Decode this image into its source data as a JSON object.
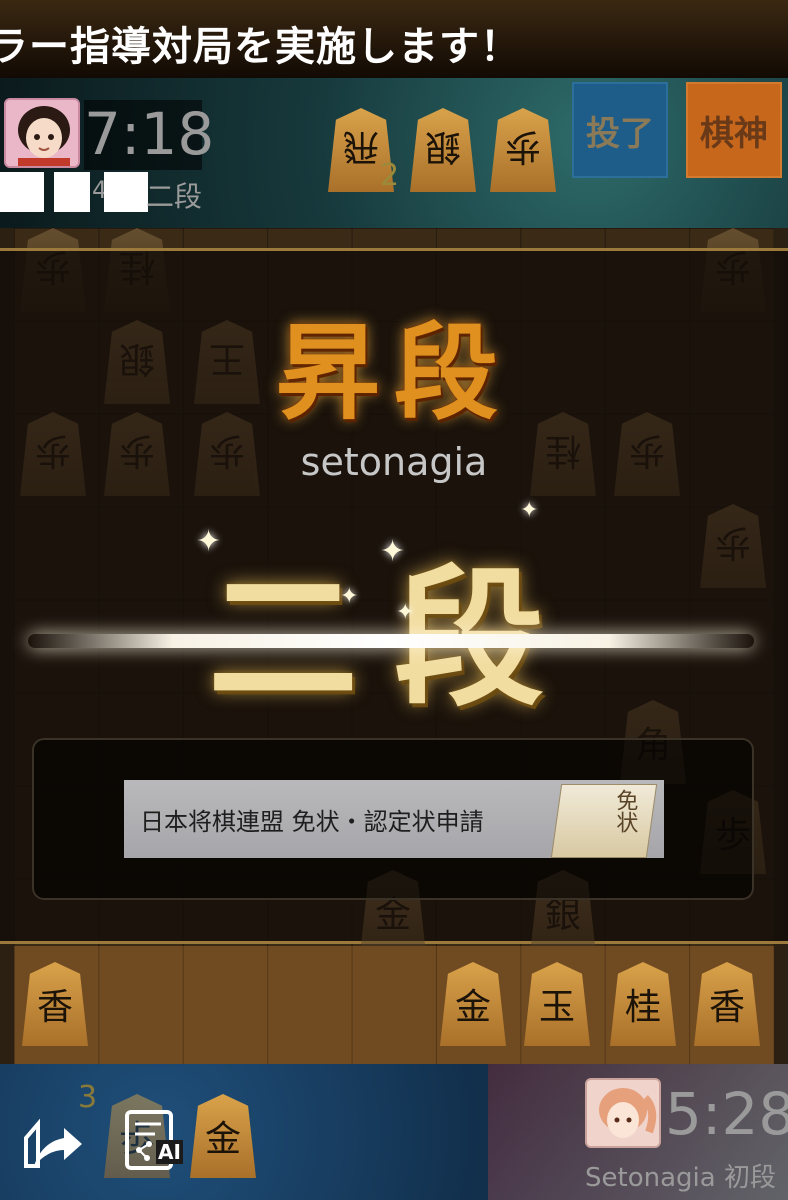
{
  "banner": {
    "text": "ラー指導対局を実施します！"
  },
  "opponent": {
    "timer": "7:18",
    "rank_fragment": "4",
    "rank": "二段",
    "avatar_icon": "girl-avatar-icon",
    "captured": [
      {
        "piece": "飛",
        "count": "2"
      },
      {
        "piece": "銀",
        "count": ""
      },
      {
        "piece": "歩",
        "count": ""
      }
    ]
  },
  "mode_buttons": {
    "end": "投了",
    "god": "棋神"
  },
  "promotion": {
    "title": "昇段",
    "username": "setonagia",
    "new_rank": "二段"
  },
  "certificate": {
    "label": "日本将棋連盟 免状・認定状申請",
    "scroll_text": "免状"
  },
  "board": {
    "back_pieces_top": [
      "歩",
      "桂",
      "歩"
    ],
    "mid_pieces": [
      "銀",
      "王",
      "歩",
      "歩",
      "歩",
      "桂",
      "歩",
      "歩",
      "角",
      "歩",
      "金",
      "銀"
    ],
    "bottom_row": [
      "香",
      "金",
      "玉",
      "桂",
      "香"
    ]
  },
  "self": {
    "timer": "5:28",
    "name": "Setonagia 初段",
    "captured": [
      {
        "piece": "歩",
        "count": "3"
      },
      {
        "piece": "金",
        "count": ""
      }
    ],
    "share_icon": "share-icon",
    "ai_icon": "ai-analysis-icon",
    "ai_label": "AI"
  },
  "colors": {
    "promo_gold": "#e0901e",
    "rank_cream": "#f2dda0",
    "end_button": "#1e5d8a",
    "god_button": "#c7671c"
  }
}
